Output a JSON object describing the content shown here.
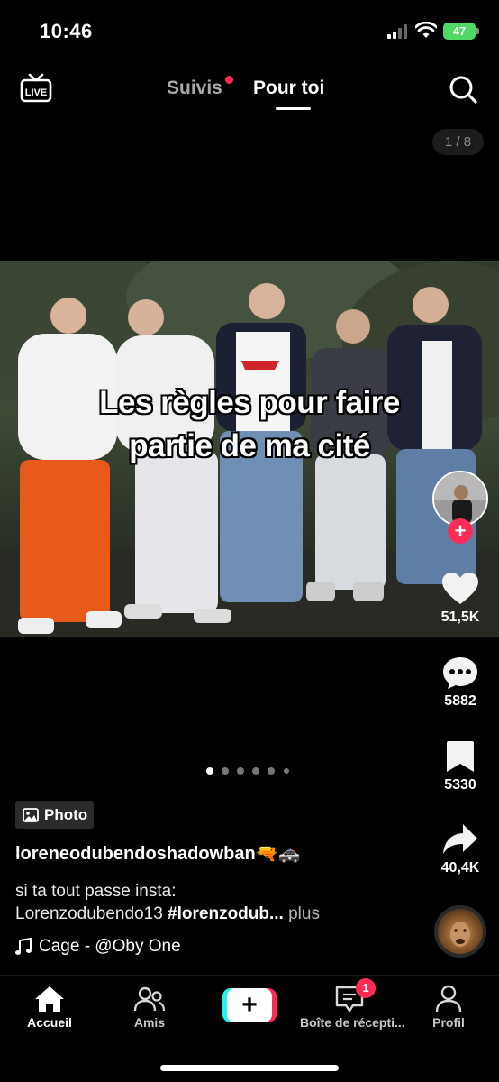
{
  "status_bar": {
    "time": "10:46",
    "battery": "47"
  },
  "top_nav": {
    "live_label": "LIVE",
    "tab_following": "Suivis",
    "tab_for_you": "Pour toi",
    "page_counter": "1 / 8"
  },
  "post": {
    "overlay_line1": "Les règles pour faire",
    "overlay_line2": "partie de ma cité",
    "badge": "Photo",
    "username": "loreneodubendoshadowban🔫🚓",
    "caption_text": "si ta tout passe insta:",
    "caption_line2_start": "Lorenzodubendo13 ",
    "caption_tag": "#lorenzodub...",
    "caption_more": " plus",
    "music": "Cage - @Oby One",
    "carousel_total": 6,
    "carousel_active": 0
  },
  "actions": {
    "likes": "51,5K",
    "comments": "5882",
    "saves": "5330",
    "shares": "40,4K"
  },
  "bottom_nav": {
    "home": "Accueil",
    "friends": "Amis",
    "create": "+",
    "inbox": "Boîte de récepti...",
    "inbox_badge": "1",
    "profile": "Profil"
  },
  "colors": {
    "accent": "#fe2c55",
    "cyan": "#25f4ee",
    "battery": "#4cd964"
  },
  "icons": [
    "live-icon",
    "search-icon",
    "heart-icon",
    "comment-icon",
    "bookmark-icon",
    "share-icon",
    "home-icon",
    "friends-icon",
    "inbox-icon",
    "profile-icon",
    "music-note-icon",
    "photo-icon"
  ]
}
